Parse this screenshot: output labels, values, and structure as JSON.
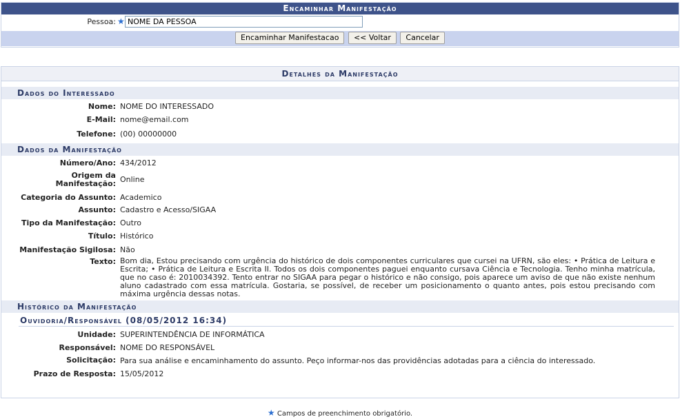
{
  "form": {
    "title": "Encaminhar Manifestação",
    "pessoa_label": "Pessoa:",
    "pessoa_value": "NOME DA PESSOA",
    "buttons": {
      "encaminhar": "Encaminhar Manifestacao",
      "voltar": "<< Voltar",
      "cancelar": "Cancelar"
    }
  },
  "details": {
    "title": "Detalhes da Manifestação",
    "interessado": {
      "heading": "Dados do Interessado",
      "nome_label": "Nome:",
      "nome": "NOME DO INTERESSADO",
      "email_label": "E-Mail:",
      "email": "nome@email.com",
      "telefone_label": "Telefone:",
      "telefone": "(00) 00000000"
    },
    "manifestacao": {
      "heading": "Dados da Manifestação",
      "numero_label": "Número/Ano:",
      "numero": "434/2012",
      "origem_label_1": "Origem da",
      "origem_label_2": "Manifestação:",
      "origem": "Online",
      "categoria_label": "Categoria do Assunto:",
      "categoria": "Academico",
      "assunto_label": "Assunto:",
      "assunto": "Cadastro e Acesso/SIGAA",
      "tipo_label": "Tipo da Manifestação:",
      "tipo": "Outro",
      "titulo_label": "Título:",
      "titulo": "Histórico",
      "sigilosa_label": "Manifestação Sigilosa:",
      "sigilosa": "Não",
      "texto_label": "Texto:",
      "texto": "Bom dia, Estou precisando com urgência do histórico de dois componentes curriculares que cursei na UFRN, são eles: • Prática de Leitura e Escrita; • Prática de Leitura e Escrita II. Todos os dois componentes paguei enquanto cursava Ciência e Tecnologia. Tenho minha matrícula, que no caso é: 2010034392. Tento entrar no SIGAA para pegar o histórico e não consigo, pois aparece um aviso de que não existe nenhum aluno cadastrado com essa matrícula. Gostaria, se possível, de receber um posicionamento o quanto antes, pois estou precisando com máxima urgência dessas notas."
    },
    "historico": {
      "heading": "Histórico da Manifestação",
      "entry_title": "Ouvidoria/Responsável (08/05/2012 16:34)",
      "unidade_label": "Unidade:",
      "unidade": "SUPERINTENDÊNCIA DE INFORMÁTICA",
      "responsavel_label": "Responsável:",
      "responsavel": "NOME DO RESPONSÁVEL",
      "solicitacao_label": "Solicitação:",
      "solicitacao": "Para sua análise e encaminhamento do assunto. Peço informar-nos das providências adotadas para a ciência do interessado.",
      "prazo_label": "Prazo de Resposta:",
      "prazo": "15/05/2012"
    }
  },
  "footer": {
    "note": "Campos de preenchimento obrigatório."
  },
  "colors": {
    "header_bar": "#3e538a",
    "section_bg": "#e7ebf4",
    "button_row_bg": "#c9d3ee",
    "required_star": "#2c6fd1"
  }
}
